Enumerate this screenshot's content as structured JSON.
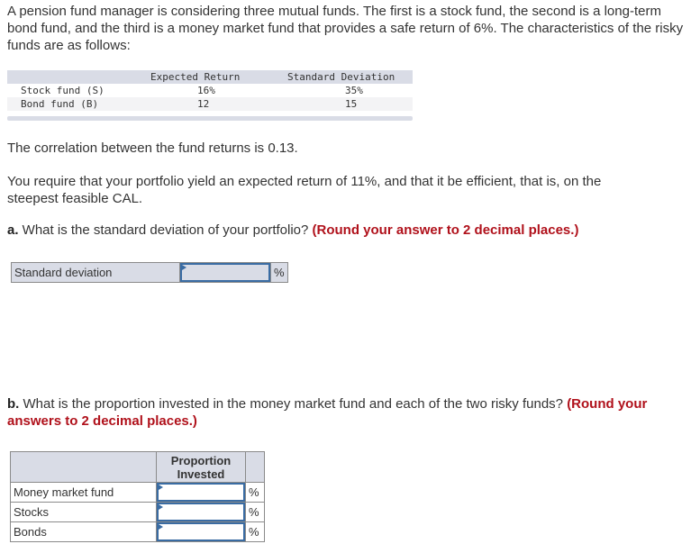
{
  "intro": "A pension fund manager is considering three mutual funds. The first is a stock fund, the second is a long-term bond fund, and the third is a money market fund that provides a safe return of 6%. The characteristics of the risky funds are as follows:",
  "fund_table": {
    "headers": [
      "",
      "Expected Return",
      "Standard Deviation"
    ],
    "rows": [
      {
        "name": "Stock fund (S)",
        "ret": "16%",
        "sd": "35%"
      },
      {
        "name": "Bond fund (B)",
        "ret": "12",
        "sd": "15"
      }
    ]
  },
  "correlation": "The correlation between the fund returns is 0.13.",
  "requirement": "You require that your portfolio yield an expected return of 11%, and that it be efficient, that is, on the steepest feasible CAL.",
  "part_a": {
    "prefix": "a.",
    "question": " What is the standard deviation of your portfolio? ",
    "hint": "(Round your answer to 2 decimal places.)",
    "label": "Standard deviation",
    "unit": "%",
    "value": ""
  },
  "part_b": {
    "prefix": "b.",
    "question": " What is the proportion invested in the money market fund and each of the two risky funds? ",
    "hint": "(Round your answers to 2 decimal places.)",
    "header": "Proportion Invested",
    "rows": [
      {
        "label": "Money market fund",
        "unit": "%",
        "value": ""
      },
      {
        "label": "Stocks",
        "unit": "%",
        "value": ""
      },
      {
        "label": "Bonds",
        "unit": "%",
        "value": ""
      }
    ]
  }
}
